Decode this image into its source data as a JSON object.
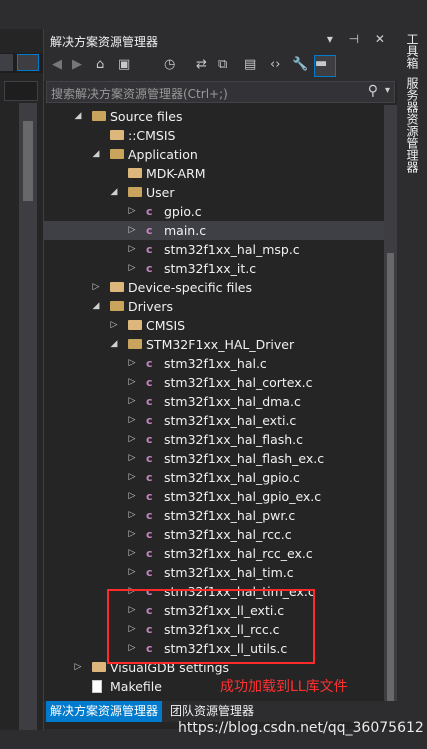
{
  "panel": {
    "title": "解决方案资源管理器",
    "title_controls": "▾ ⊣ ✕",
    "search_placeholder": "搜索解决方案资源管理器(Ctrl+;)",
    "tabs": [
      "解决方案资源管理器",
      "团队资源管理器"
    ]
  },
  "right_vertical_tabs": [
    "工具箱",
    "服务器资源管理器"
  ],
  "tree": [
    {
      "label": "Source files",
      "type": "folder-open",
      "expanded": true
    },
    {
      "label": "::CMSIS",
      "type": "folder",
      "expanded": null
    },
    {
      "label": "Application",
      "type": "folder-open",
      "expanded": true
    },
    {
      "label": "MDK-ARM",
      "type": "folder",
      "expanded": null
    },
    {
      "label": "User",
      "type": "folder-open",
      "expanded": true
    },
    {
      "label": "gpio.c",
      "type": "c-file",
      "expanded": false
    },
    {
      "label": "main.c",
      "type": "c-file",
      "expanded": false,
      "selected": true
    },
    {
      "label": "stm32f1xx_hal_msp.c",
      "type": "c-file",
      "expanded": false
    },
    {
      "label": "stm32f1xx_it.c",
      "type": "c-file",
      "expanded": false
    },
    {
      "label": "Device-specific files",
      "type": "folder",
      "expanded": false
    },
    {
      "label": "Drivers",
      "type": "folder-open",
      "expanded": true
    },
    {
      "label": "CMSIS",
      "type": "folder",
      "expanded": false
    },
    {
      "label": "STM32F1xx_HAL_Driver",
      "type": "folder-open",
      "expanded": true
    },
    {
      "label": "stm32f1xx_hal.c",
      "type": "c-file",
      "expanded": false
    },
    {
      "label": "stm32f1xx_hal_cortex.c",
      "type": "c-file",
      "expanded": false
    },
    {
      "label": "stm32f1xx_hal_dma.c",
      "type": "c-file",
      "expanded": false
    },
    {
      "label": "stm32f1xx_hal_exti.c",
      "type": "c-file",
      "expanded": false
    },
    {
      "label": "stm32f1xx_hal_flash.c",
      "type": "c-file",
      "expanded": false
    },
    {
      "label": "stm32f1xx_hal_flash_ex.c",
      "type": "c-file",
      "expanded": false
    },
    {
      "label": "stm32f1xx_hal_gpio.c",
      "type": "c-file",
      "expanded": false
    },
    {
      "label": "stm32f1xx_hal_gpio_ex.c",
      "type": "c-file",
      "expanded": false
    },
    {
      "label": "stm32f1xx_hal_pwr.c",
      "type": "c-file",
      "expanded": false
    },
    {
      "label": "stm32f1xx_hal_rcc.c",
      "type": "c-file",
      "expanded": false
    },
    {
      "label": "stm32f1xx_hal_rcc_ex.c",
      "type": "c-file",
      "expanded": false
    },
    {
      "label": "stm32f1xx_hal_tim.c",
      "type": "c-file",
      "expanded": false
    },
    {
      "label": "stm32f1xx_hal_tim_ex.c",
      "type": "c-file",
      "expanded": false
    },
    {
      "label": "stm32f1xx_ll_exti.c",
      "type": "c-file",
      "expanded": false
    },
    {
      "label": "stm32f1xx_ll_rcc.c",
      "type": "c-file",
      "expanded": false
    },
    {
      "label": "stm32f1xx_ll_utils.c",
      "type": "c-file",
      "expanded": false
    },
    {
      "label": "VisualGDB settings",
      "type": "folder",
      "expanded": false
    },
    {
      "label": "Makefile",
      "type": "file",
      "expanded": null
    }
  ],
  "annotation": "成功加载到LL库文件",
  "watermark": "https://blog.csdn.net/qq_36075612",
  "colors": {
    "accent": "#007acc",
    "annotation": "#ff2a2a",
    "folder": "#dcb67a",
    "c_icon": "#c586c0"
  }
}
